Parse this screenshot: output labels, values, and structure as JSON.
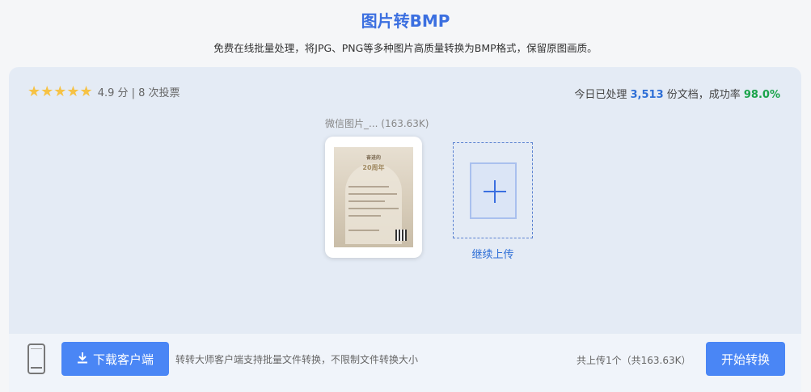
{
  "header": {
    "title": "图片转BMP",
    "subtitle": "免费在线批量处理，将JPG、PNG等多种图片高质量转换为BMP格式，保留原图画质。"
  },
  "rating": {
    "stars": "★★★★★",
    "score_text": "4.9 分 | 8 次投票"
  },
  "stats": {
    "prefix": "今日已处理 ",
    "count": "3,513",
    "middle": " 份文档，成功率 ",
    "rate": "98.0%"
  },
  "file": {
    "caption": "微信图片_... (163.63K)",
    "thumb_title": "奋进的",
    "thumb_year": "20周年"
  },
  "upload_more": {
    "label": "继续上传"
  },
  "footer": {
    "download_label": "下载客户端",
    "note": "转转大师客户端支持批量文件转换，不限制文件转换大小",
    "summary": "共上传1个（共163.63K）",
    "start_label": "开始转换"
  },
  "colors": {
    "accent": "#3b6fe0",
    "button": "#4a86f5",
    "success": "#1aa34a",
    "star": "#f6c244"
  }
}
